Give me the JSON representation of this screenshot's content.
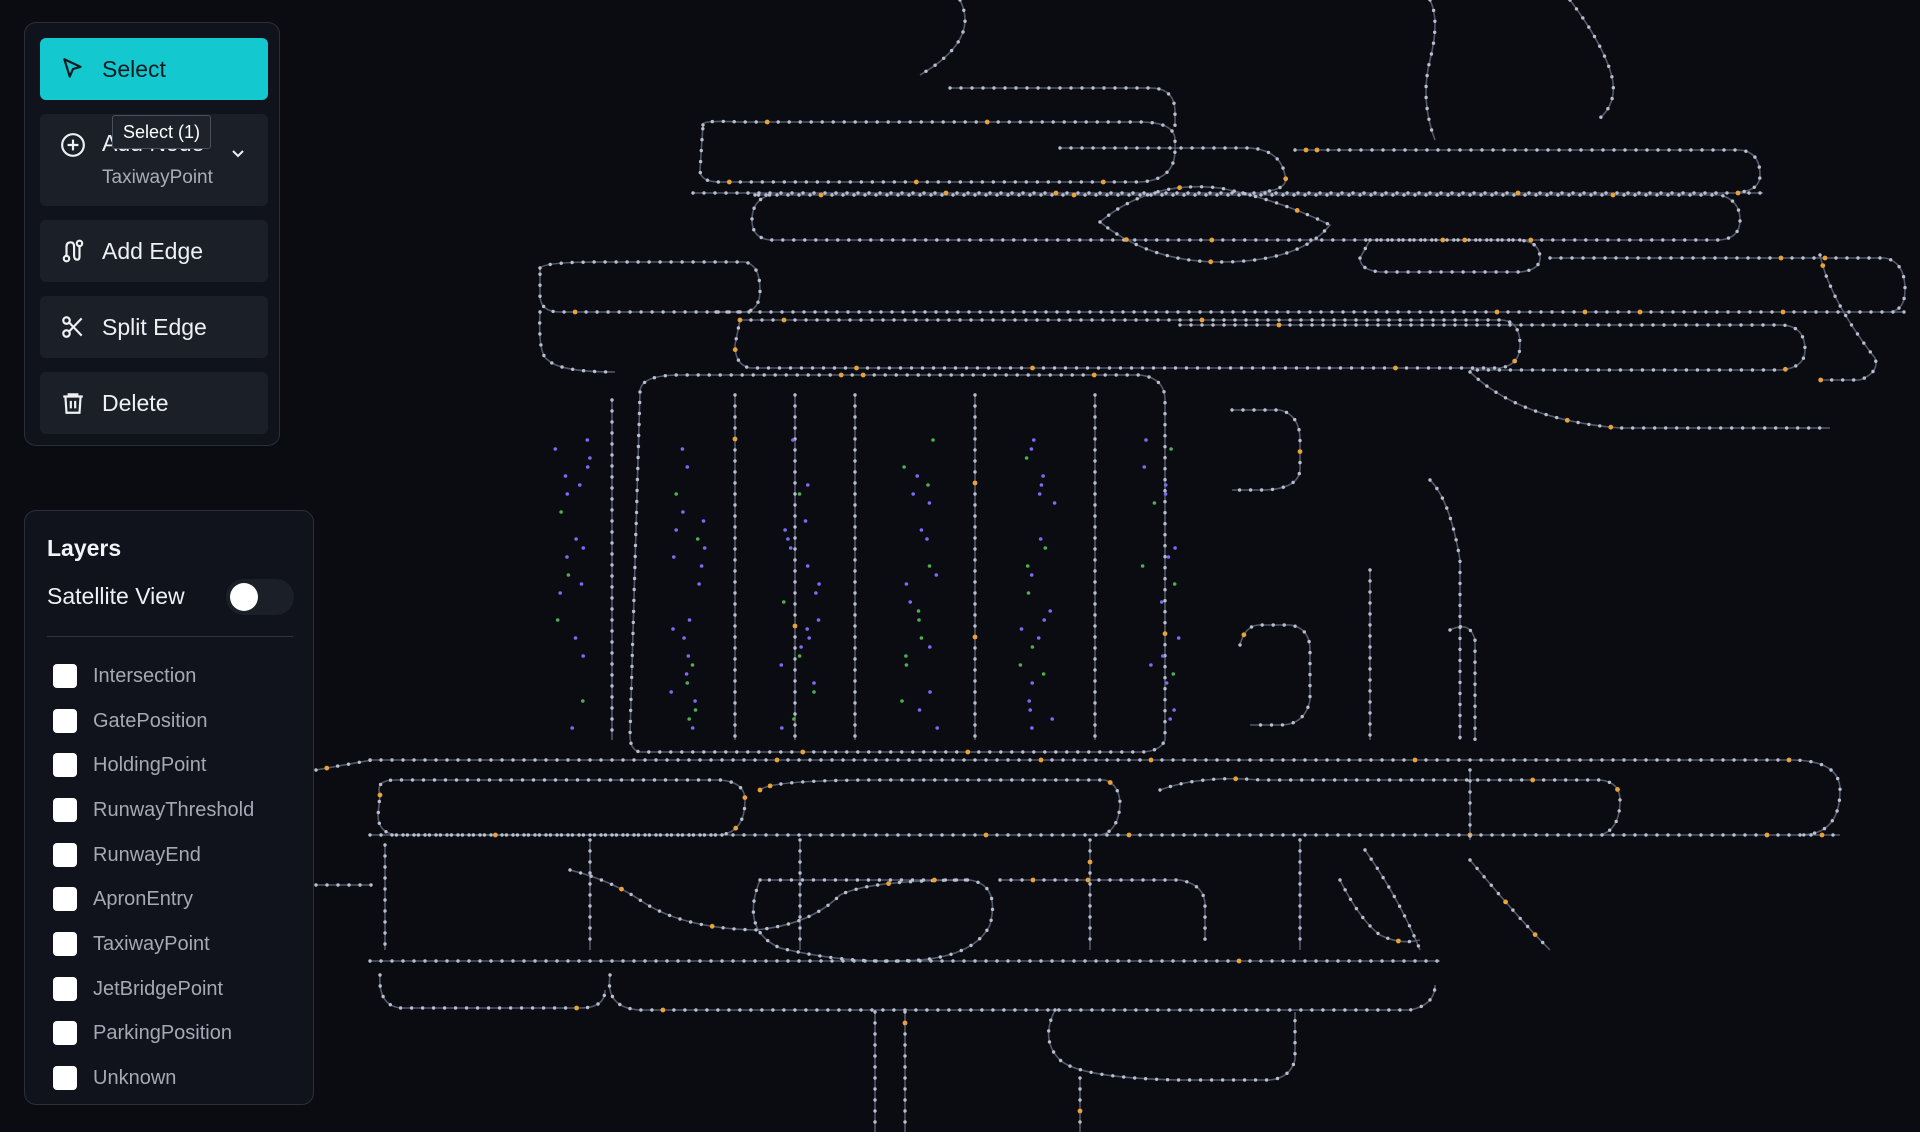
{
  "toolbar": {
    "tools": [
      {
        "id": "select",
        "label": "Select",
        "icon": "cursor-arrow-icon",
        "active": true
      },
      {
        "id": "add-node",
        "label": "Add Node",
        "sublabel": "TaxiwayPoint",
        "icon": "plus-circle-icon"
      },
      {
        "id": "add-edge",
        "label": "Add Edge",
        "icon": "route-icon"
      },
      {
        "id": "split-edge",
        "label": "Split Edge",
        "icon": "scissors-icon"
      },
      {
        "id": "delete",
        "label": "Delete",
        "icon": "trash-icon"
      }
    ],
    "tooltip": "Select (1)"
  },
  "layers": {
    "title": "Layers",
    "satellite_label": "Satellite View",
    "satellite_on": false,
    "items": [
      "Intersection",
      "GatePosition",
      "HoldingPoint",
      "RunwayThreshold",
      "RunwayEnd",
      "ApronEntry",
      "TaxiwayPoint",
      "JetBridgePoint",
      "ParkingPosition",
      "Unknown"
    ]
  },
  "colors": {
    "background": "#0b0c11",
    "accent": "#14c8cf",
    "edge": "#6b7286",
    "node": "#b9bfd0",
    "node_highlight": "#e8a23a",
    "node_parking": "#7b6cf6",
    "node_jetbridge": "#4caf50"
  }
}
